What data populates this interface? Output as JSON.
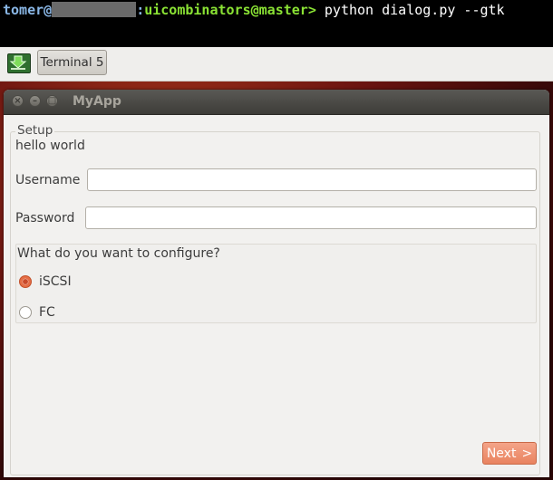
{
  "terminal": {
    "user": "tomer",
    "at": "@",
    "sep": ":",
    "path": "uicombinators@master",
    "prompt": ">",
    "command": " python dialog.py --gtk"
  },
  "taskbar": {
    "terminal_button_label": "Terminal 5",
    "download_icon": "download-arrow-icon"
  },
  "window": {
    "title": "MyApp",
    "controls": [
      "close",
      "minimize",
      "maximize"
    ]
  },
  "setup": {
    "legend": "Setup",
    "greeting": "hello world",
    "username_label": "Username",
    "username_value": "",
    "password_label": "Password",
    "password_value": ""
  },
  "configure": {
    "question": "What do you want to configure?",
    "options": [
      {
        "label": "iSCSI",
        "selected": true
      },
      {
        "label": "FC",
        "selected": false
      }
    ]
  },
  "footer": {
    "next_label": "Next",
    "next_arrow": ">"
  },
  "colors": {
    "accent": "#e9835f",
    "terminal_user": "#8ab7e6",
    "terminal_path": "#8ae234"
  }
}
